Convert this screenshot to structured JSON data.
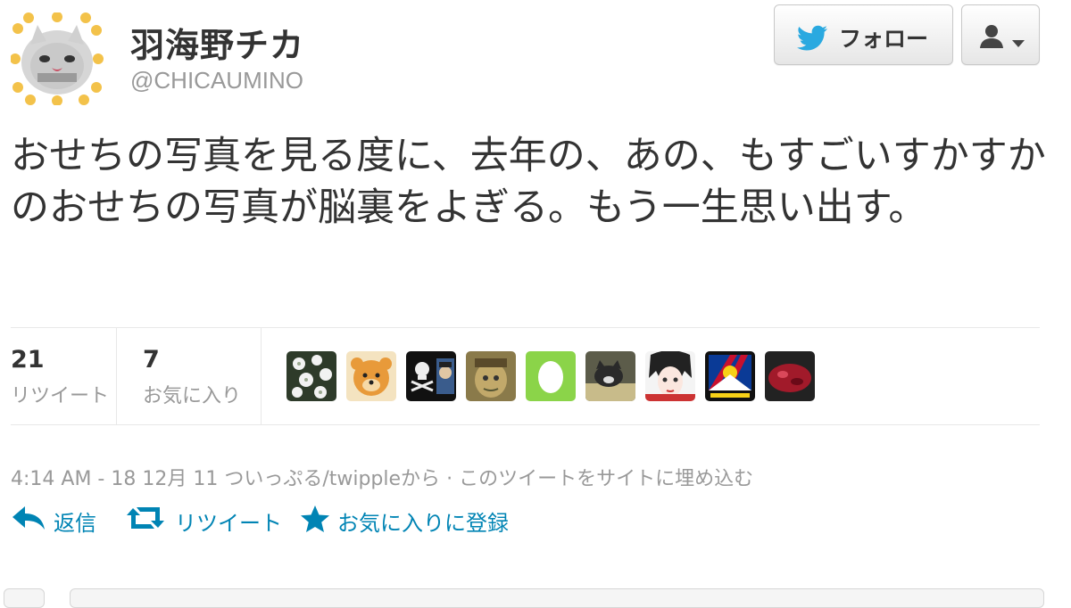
{
  "user": {
    "display_name": "羽海野チカ",
    "screen_name": "@CHICAUMINO",
    "avatar": "cat-avatar"
  },
  "header": {
    "follow_label": "フォロー",
    "follow_icon": "twitter-bird-icon",
    "user_menu_icon": "user-dropdown-icon"
  },
  "tweet": {
    "text": "おせちの写真を見る度に、去年の、あの、もすごいすかすかのおせちの写真が脳裏をよぎる。もう一生思い出す。"
  },
  "stats": {
    "retweets": {
      "count": "21",
      "label": "リツイート"
    },
    "favorites": {
      "count": "7",
      "label": "お気に入り"
    }
  },
  "favoriters": [
    "white-flowers-avatar",
    "orange-bear-avatar",
    "pirate-flag-avatar",
    "character-avatar",
    "egg-avatar",
    "cat-photo-avatar",
    "manga-girl-avatar",
    "tibet-flag-avatar",
    "red-object-avatar"
  ],
  "meta": {
    "time": "4:14 AM - 18 12月 11",
    "via": "ついっぷる/twippleから",
    "separator": "·",
    "embed": "このツイートをサイトに埋め込む"
  },
  "actions": {
    "reply": "返信",
    "retweet": "リツイート",
    "favorite": "お気に入りに登録"
  },
  "colors": {
    "link": "#0084b4",
    "muted": "#999999",
    "text": "#333333",
    "twitter_blue": "#2aa9e0"
  }
}
